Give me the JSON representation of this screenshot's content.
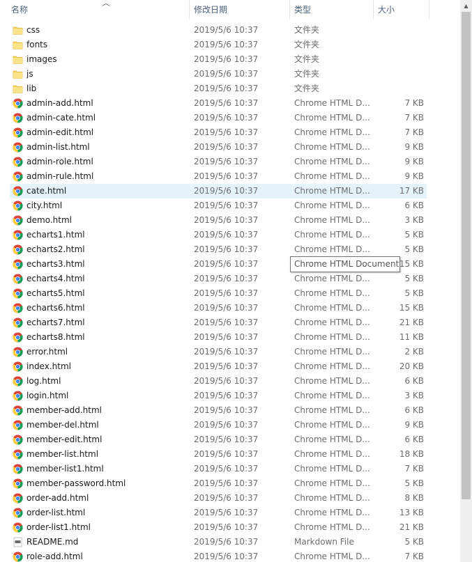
{
  "columns": {
    "name": "名称",
    "date": "修改日期",
    "type": "类型",
    "size": "大小"
  },
  "tooltip": "Chrome HTML Document",
  "colors": {
    "folder": "#f7d560",
    "selected_row": "#e5f3fb",
    "header_text": "#4c607a"
  },
  "files": [
    {
      "name": "css",
      "date": "2019/5/6 10:37",
      "type": "文件夹",
      "size": "",
      "icon": "folder-icon"
    },
    {
      "name": "fonts",
      "date": "2019/5/6 10:37",
      "type": "文件夹",
      "size": "",
      "icon": "folder-icon"
    },
    {
      "name": "images",
      "date": "2019/5/6 10:37",
      "type": "文件夹",
      "size": "",
      "icon": "folder-icon"
    },
    {
      "name": "js",
      "date": "2019/5/6 10:37",
      "type": "文件夹",
      "size": "",
      "icon": "folder-icon"
    },
    {
      "name": "lib",
      "date": "2019/5/6 10:37",
      "type": "文件夹",
      "size": "",
      "icon": "folder-icon"
    },
    {
      "name": "admin-add.html",
      "date": "2019/5/6 10:37",
      "type": "Chrome HTML D...",
      "size": "7 KB",
      "icon": "chrome-icon"
    },
    {
      "name": "admin-cate.html",
      "date": "2019/5/6 10:37",
      "type": "Chrome HTML D...",
      "size": "7 KB",
      "icon": "chrome-icon"
    },
    {
      "name": "admin-edit.html",
      "date": "2019/5/6 10:37",
      "type": "Chrome HTML D...",
      "size": "7 KB",
      "icon": "chrome-icon"
    },
    {
      "name": "admin-list.html",
      "date": "2019/5/6 10:37",
      "type": "Chrome HTML D...",
      "size": "9 KB",
      "icon": "chrome-icon"
    },
    {
      "name": "admin-role.html",
      "date": "2019/5/6 10:37",
      "type": "Chrome HTML D...",
      "size": "9 KB",
      "icon": "chrome-icon"
    },
    {
      "name": "admin-rule.html",
      "date": "2019/5/6 10:37",
      "type": "Chrome HTML D...",
      "size": "9 KB",
      "icon": "chrome-icon"
    },
    {
      "name": "cate.html",
      "date": "2019/5/6 10:37",
      "type": "Chrome HTML D...",
      "size": "17 KB",
      "icon": "chrome-icon",
      "selected": true
    },
    {
      "name": "city.html",
      "date": "2019/5/6 10:37",
      "type": "Chrome HTML D...",
      "size": "6 KB",
      "icon": "chrome-icon"
    },
    {
      "name": "demo.html",
      "date": "2019/5/6 10:37",
      "type": "Chrome HTML D...",
      "size": "3 KB",
      "icon": "chrome-icon"
    },
    {
      "name": "echarts1.html",
      "date": "2019/5/6 10:37",
      "type": "Chrome HTML D...",
      "size": "5 KB",
      "icon": "chrome-icon"
    },
    {
      "name": "echarts2.html",
      "date": "2019/5/6 10:37",
      "type": "Chrome HTML D...",
      "size": "5 KB",
      "icon": "chrome-icon"
    },
    {
      "name": "echarts3.html",
      "date": "2019/5/6 10:37",
      "type": "Chrome HTML D...",
      "size": "15 KB",
      "icon": "chrome-icon"
    },
    {
      "name": "echarts4.html",
      "date": "2019/5/6 10:37",
      "type": "Chrome HTML D...",
      "size": "5 KB",
      "icon": "chrome-icon"
    },
    {
      "name": "echarts5.html",
      "date": "2019/5/6 10:37",
      "type": "Chrome HTML D...",
      "size": "5 KB",
      "icon": "chrome-icon"
    },
    {
      "name": "echarts6.html",
      "date": "2019/5/6 10:37",
      "type": "Chrome HTML D...",
      "size": "15 KB",
      "icon": "chrome-icon"
    },
    {
      "name": "echarts7.html",
      "date": "2019/5/6 10:37",
      "type": "Chrome HTML D...",
      "size": "21 KB",
      "icon": "chrome-icon"
    },
    {
      "name": "echarts8.html",
      "date": "2019/5/6 10:37",
      "type": "Chrome HTML D...",
      "size": "11 KB",
      "icon": "chrome-icon"
    },
    {
      "name": "error.html",
      "date": "2019/5/6 10:37",
      "type": "Chrome HTML D...",
      "size": "2 KB",
      "icon": "chrome-icon"
    },
    {
      "name": "index.html",
      "date": "2019/5/6 10:37",
      "type": "Chrome HTML D...",
      "size": "20 KB",
      "icon": "chrome-icon"
    },
    {
      "name": "log.html",
      "date": "2019/5/6 10:37",
      "type": "Chrome HTML D...",
      "size": "6 KB",
      "icon": "chrome-icon"
    },
    {
      "name": "login.html",
      "date": "2019/5/6 10:37",
      "type": "Chrome HTML D...",
      "size": "3 KB",
      "icon": "chrome-icon"
    },
    {
      "name": "member-add.html",
      "date": "2019/5/6 10:37",
      "type": "Chrome HTML D...",
      "size": "6 KB",
      "icon": "chrome-icon"
    },
    {
      "name": "member-del.html",
      "date": "2019/5/6 10:37",
      "type": "Chrome HTML D...",
      "size": "9 KB",
      "icon": "chrome-icon"
    },
    {
      "name": "member-edit.html",
      "date": "2019/5/6 10:37",
      "type": "Chrome HTML D...",
      "size": "6 KB",
      "icon": "chrome-icon"
    },
    {
      "name": "member-list.html",
      "date": "2019/5/6 10:37",
      "type": "Chrome HTML D...",
      "size": "18 KB",
      "icon": "chrome-icon"
    },
    {
      "name": "member-list1.html",
      "date": "2019/5/6 10:37",
      "type": "Chrome HTML D...",
      "size": "7 KB",
      "icon": "chrome-icon"
    },
    {
      "name": "member-password.html",
      "date": "2019/5/6 10:37",
      "type": "Chrome HTML D...",
      "size": "5 KB",
      "icon": "chrome-icon"
    },
    {
      "name": "order-add.html",
      "date": "2019/5/6 10:37",
      "type": "Chrome HTML D...",
      "size": "8 KB",
      "icon": "chrome-icon"
    },
    {
      "name": "order-list.html",
      "date": "2019/5/6 10:37",
      "type": "Chrome HTML D...",
      "size": "13 KB",
      "icon": "chrome-icon"
    },
    {
      "name": "order-list1.html",
      "date": "2019/5/6 10:37",
      "type": "Chrome HTML D...",
      "size": "21 KB",
      "icon": "chrome-icon"
    },
    {
      "name": "README.md",
      "date": "2019/5/6 10:37",
      "type": "Markdown File",
      "size": "5 KB",
      "icon": "markdown-file-icon"
    },
    {
      "name": "role-add.html",
      "date": "2019/5/6 10:37",
      "type": "Chrome HTML D...",
      "size": "7 KB",
      "icon": "chrome-icon"
    }
  ]
}
